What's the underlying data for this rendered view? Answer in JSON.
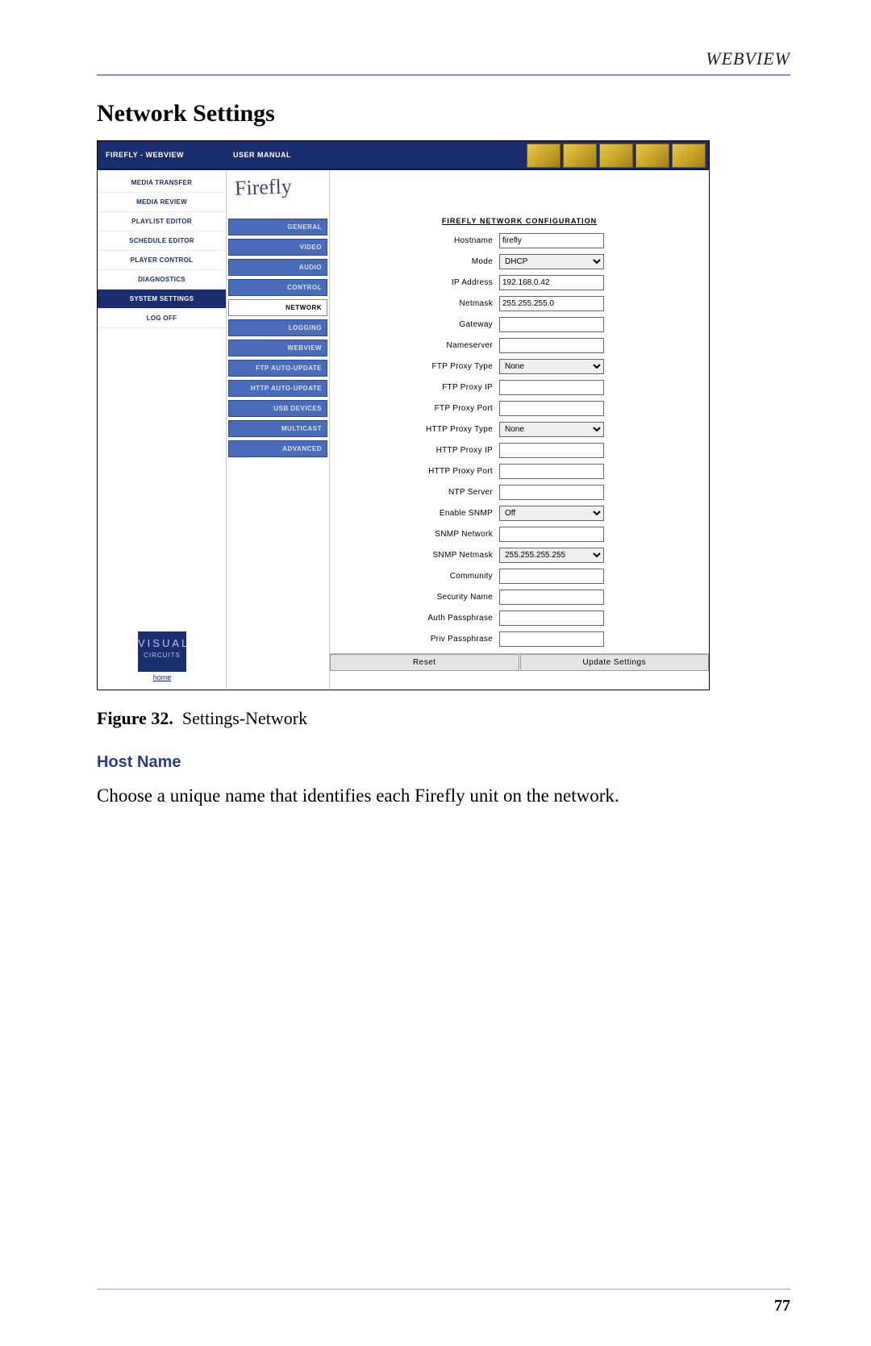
{
  "header": {
    "label": "WEBVIEW"
  },
  "section_title": "Network Settings",
  "topbar": {
    "left": "FIREFLY - WEBVIEW",
    "mid": "USER MANUAL"
  },
  "left_nav": [
    {
      "label": "MEDIA TRANSFER",
      "active": false
    },
    {
      "label": "MEDIA REVIEW",
      "active": false
    },
    {
      "label": "PLAYLIST EDITOR",
      "active": false
    },
    {
      "label": "SCHEDULE EDITOR",
      "active": false
    },
    {
      "label": "PLAYER CONTROL",
      "active": false
    },
    {
      "label": "DIAGNOSTICS",
      "active": false
    },
    {
      "label": "SYSTEM SETTINGS",
      "active": true
    },
    {
      "label": "LOG OFF",
      "active": false
    }
  ],
  "vc": {
    "line1": "VISUAL",
    "line2": "CIRCUITS",
    "home": "home"
  },
  "logo_text": "Firefly",
  "sub_nav": [
    {
      "label": "GENERAL",
      "active": false
    },
    {
      "label": "VIDEO",
      "active": false
    },
    {
      "label": "AUDIO",
      "active": false
    },
    {
      "label": "CONTROL",
      "active": false
    },
    {
      "label": "NETWORK",
      "active": true
    },
    {
      "label": "LOGGING",
      "active": false
    },
    {
      "label": "WEBVIEW",
      "active": false
    },
    {
      "label": "FTP AUTO-UPDATE",
      "active": false
    },
    {
      "label": "HTTP AUTO-UPDATE",
      "active": false
    },
    {
      "label": "USB DEVICES",
      "active": false
    },
    {
      "label": "MULTICAST",
      "active": false
    },
    {
      "label": "ADVANCED",
      "active": false
    }
  ],
  "form": {
    "title": "FIREFLY NETWORK CONFIGURATION",
    "rows": [
      {
        "label": "Hostname",
        "type": "text",
        "value": "firefly"
      },
      {
        "label": "Mode",
        "type": "select",
        "value": "DHCP"
      },
      {
        "label": "IP Address",
        "type": "text",
        "value": "192.168.0.42"
      },
      {
        "label": "Netmask",
        "type": "text",
        "value": "255.255.255.0"
      },
      {
        "label": "Gateway",
        "type": "text",
        "value": ""
      },
      {
        "label": "Nameserver",
        "type": "text",
        "value": ""
      },
      {
        "label": "FTP Proxy Type",
        "type": "select",
        "value": "None"
      },
      {
        "label": "FTP Proxy IP",
        "type": "text",
        "value": ""
      },
      {
        "label": "FTP Proxy Port",
        "type": "text",
        "value": ""
      },
      {
        "label": "HTTP Proxy Type",
        "type": "select",
        "value": "None"
      },
      {
        "label": "HTTP Proxy IP",
        "type": "text",
        "value": ""
      },
      {
        "label": "HTTP Proxy Port",
        "type": "text",
        "value": ""
      },
      {
        "label": "NTP Server",
        "type": "text",
        "value": ""
      },
      {
        "label": "Enable SNMP",
        "type": "select",
        "value": "Off"
      },
      {
        "label": "SNMP Network",
        "type": "text",
        "value": ""
      },
      {
        "label": "SNMP Netmask",
        "type": "select",
        "value": "255.255.255.255"
      },
      {
        "label": "Community",
        "type": "text",
        "value": ""
      },
      {
        "label": "Security Name",
        "type": "text",
        "value": ""
      },
      {
        "label": "Auth Passphrase",
        "type": "text",
        "value": ""
      },
      {
        "label": "Priv Passphrase",
        "type": "text",
        "value": ""
      }
    ],
    "buttons": {
      "reset": "Reset",
      "update": "Update Settings"
    }
  },
  "caption": {
    "prefix": "Figure 32.",
    "text": "Settings-Network"
  },
  "subhead": "Host Name",
  "body_text": "Choose a unique name that identifies each Firefly unit on the network.",
  "page_number": "77"
}
